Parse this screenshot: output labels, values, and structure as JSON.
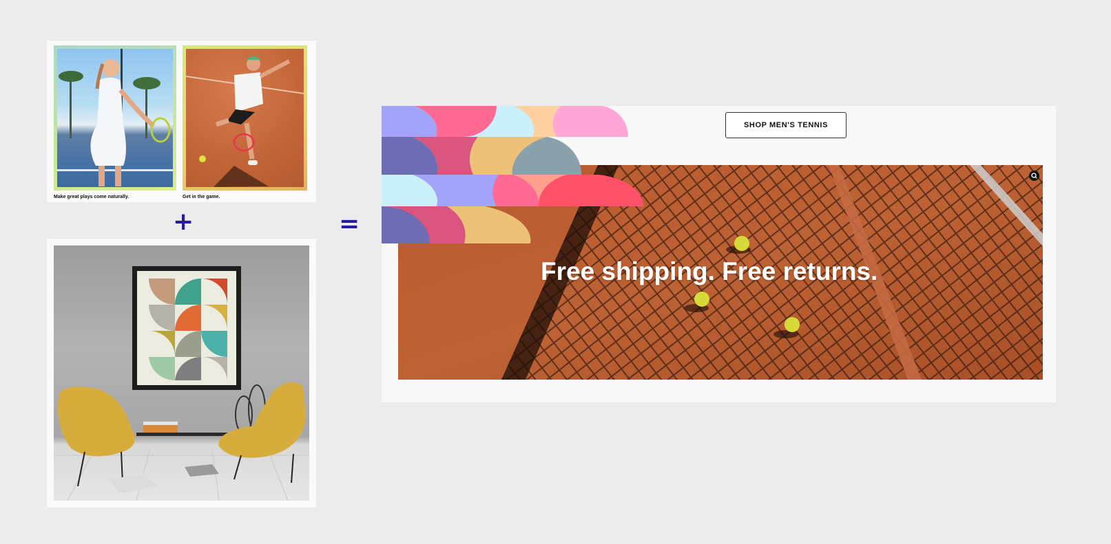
{
  "tennis_card": {
    "caption_left": "Make great plays come naturally.",
    "caption_right": "Get in the game."
  },
  "operators": {
    "plus": "+",
    "equals": "="
  },
  "banner": {
    "button_label": "SHOP MEN'S TENNIS",
    "headline": "Free shipping. Free returns."
  },
  "colors": {
    "page_background": "#ececec",
    "operator": "#2a1a9e",
    "clay": "#b85a30",
    "pattern": [
      "#a3a3f9",
      "#ff6a94",
      "#c9f0fb",
      "#ffd1a0",
      "#ffa6d6",
      "#6e6cb3",
      "#d9547e",
      "#eec178",
      "#8aa1ab",
      "#ff9f8e",
      "#ff516a"
    ]
  },
  "icons": {
    "zoom": "zoom-in-icon"
  }
}
